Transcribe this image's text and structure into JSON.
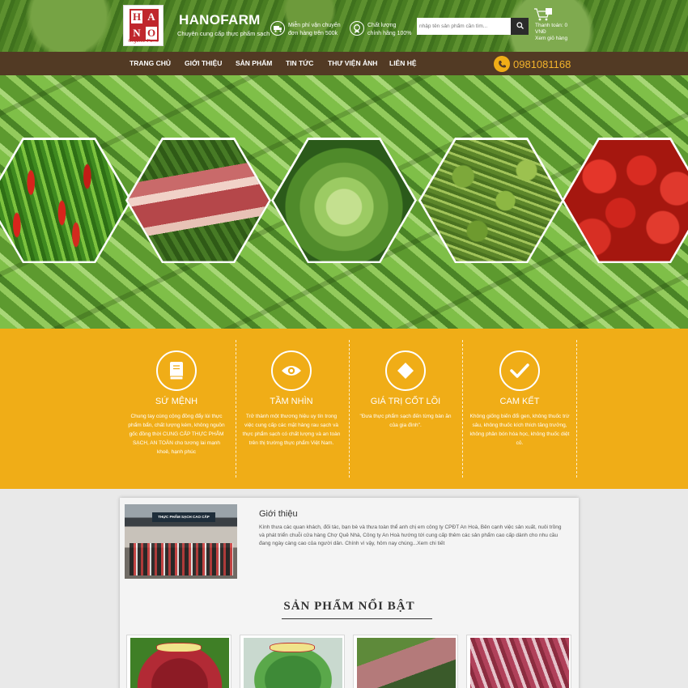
{
  "header": {
    "logo": {
      "letters": [
        "H",
        "A",
        "N",
        "O"
      ],
      "sub": "Organic Farm"
    },
    "brand": "HANOFARM",
    "tagline": "Chuyên cung cấp thực phẩm sạch",
    "features": [
      {
        "icon": "truck-icon",
        "line1": "Miễn phí vận chuyển",
        "line2": "đơn hàng trên 500k"
      },
      {
        "icon": "award-icon",
        "line1": "Chất lượng",
        "line2": "chính hãng 100%"
      }
    ],
    "search": {
      "placeholder": "nhập tên sản phẩm cần tìm..."
    },
    "cart": {
      "line1": "Thanh toán: 0",
      "line2": "VNĐ",
      "line3": "Xem giỏ hàng",
      "count": "0"
    }
  },
  "nav": {
    "items": [
      "TRANG CHỦ",
      "GIỚI THIỆU",
      "SẢN PHẨM",
      "TIN TỨC",
      "THƯ VIỆN ẢNH",
      "LIÊN HỆ"
    ],
    "phone": "0981081168"
  },
  "hero": {
    "tiles": [
      "chili",
      "meat",
      "cabbage",
      "herb",
      "tomato"
    ]
  },
  "values": [
    {
      "icon": "book-icon",
      "title": "SỨ MỆNH",
      "text": "Chung tay cùng cộng đồng đẩy lùi thực phẩm bẩn, chất lượng kém, không nguồn gốc đồng thời CUNG CẤP THỰC PHẨM SẠCH, AN TOÀN cho tương lai mạnh khoẻ, hạnh phúc"
    },
    {
      "icon": "eye-icon",
      "title": "TẦM NHÌN",
      "text": "Trở thành một thương hiệu uy tín trong việc cung cấp các mặt hàng rau sạch và thực phẩm sạch có chất lượng và an toàn trên thị trường thực phẩm Việt Nam."
    },
    {
      "icon": "diamond-icon",
      "title": "GIÁ TRỊ CỐT LÕI",
      "text": "\"Đưa thực phẩm sạch đến từng bàn ăn của gia đình\"."
    },
    {
      "icon": "check-icon",
      "title": "CAM KẾT",
      "text": "Không giống biến đổi gen, không thuốc trừ sâu, không thuốc kích thích tăng trưởng, không phân bón hóa học, không thuốc diệt cỏ."
    }
  ],
  "intro": {
    "banner": "THỰC PHẨM SẠCH CAO CẤP",
    "title": "Giới thiệu",
    "text": "Kính thưa các quan khách, đối tác, bạn bè và thưa toàn thể anh chị em công ty CPĐT An Hoà, Bên cạnh việc sản xuất, nuôi trồng và phát triển chuỗi cửa hàng Chợ Quê Nhà, Công ty An Hoà hướng tới cung cấp thêm các sản phẩm cao cấp dành cho nhu cầu đang ngày càng cao của người dân. Chính vì vậy, hôm nay chúng...Xem chi tiết"
  },
  "featured": {
    "title": "SẢN PHẨM NỔI BẬT"
  },
  "colors": {
    "accent": "#f0ad17",
    "nav": "#523a24",
    "phone": "#f3b42b",
    "brand_red": "#c0262c"
  }
}
